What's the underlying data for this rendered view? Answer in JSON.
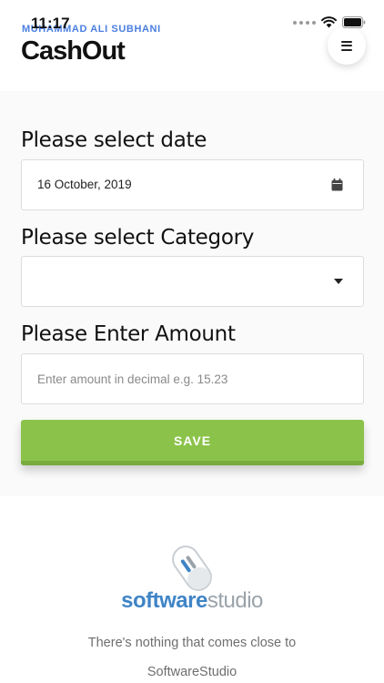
{
  "status_bar": {
    "time": "11:17"
  },
  "header": {
    "author": "MUHAMMAD ALI SUBHANI",
    "title": "CashOut",
    "menu_icon": "hamburger-menu-icon"
  },
  "form": {
    "date": {
      "label": "Please select date",
      "value": "16 October, 2019",
      "icon": "calendar-icon"
    },
    "category": {
      "label": "Please select Category",
      "value": "",
      "icon": "dropdown-caret-icon"
    },
    "amount": {
      "label": "Please Enter Amount",
      "value": "",
      "placeholder": "Enter amount in decimal e.g. 15.23"
    },
    "save_label": "SAVE"
  },
  "footer": {
    "logo_bold": "software",
    "logo_light": "studio",
    "tagline_line1": "There's nothing that comes close to",
    "tagline_line2": "SoftwareStudio"
  },
  "colors": {
    "accent_green": "#8bc34a",
    "author_blue": "#4a7fe0",
    "logo_blue": "#3f84c6",
    "logo_gray": "#9aa3aa"
  }
}
